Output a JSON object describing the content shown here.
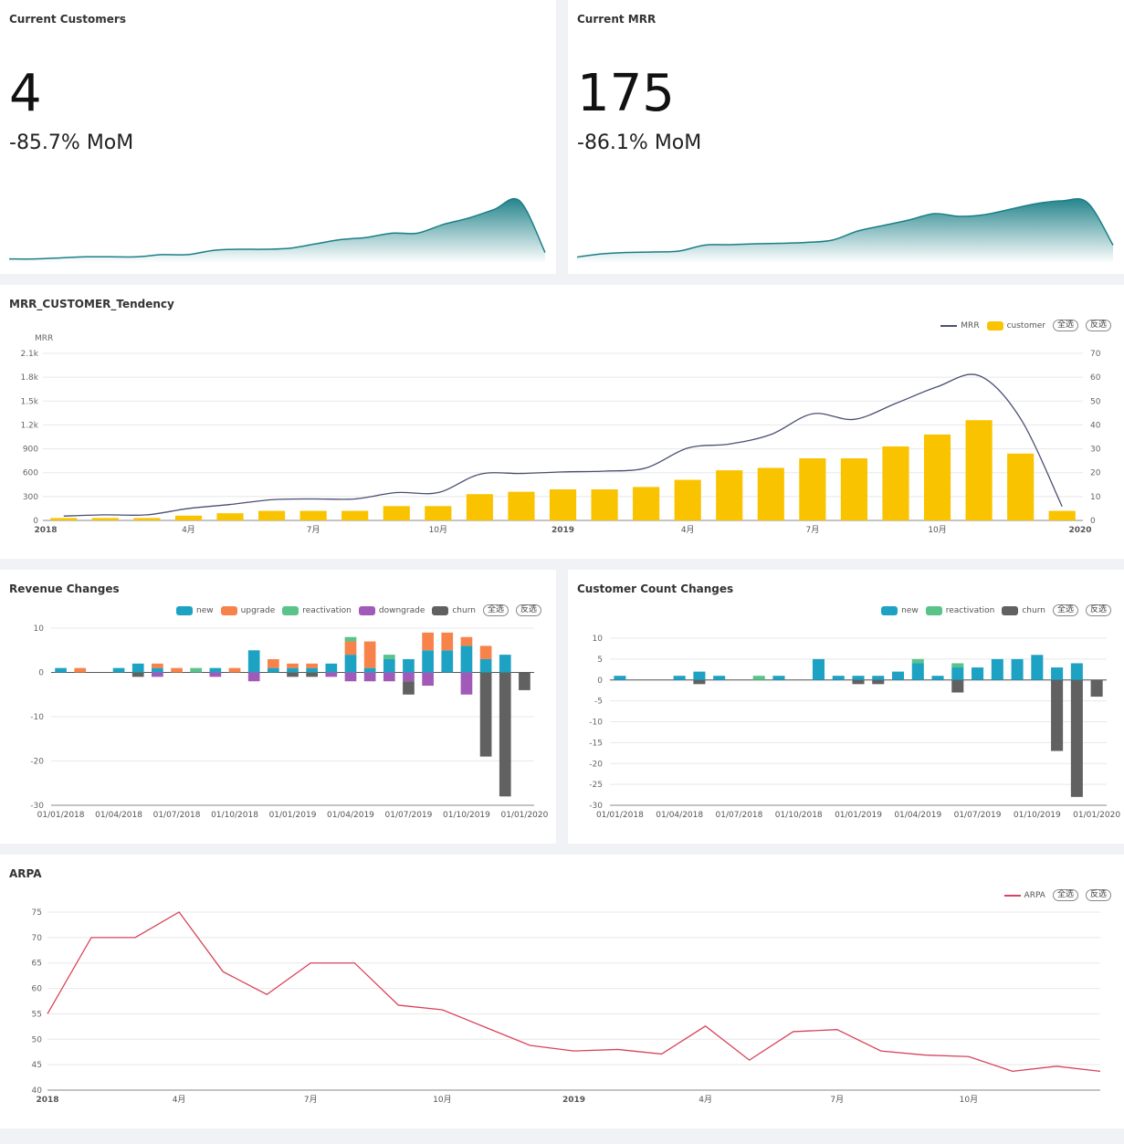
{
  "kpi": [
    {
      "title": "Current Customers",
      "value": "4",
      "mom": "-85.7% MoM"
    },
    {
      "title": "Current MRR",
      "value": "175",
      "mom": "-86.1% MoM"
    }
  ],
  "controls": {
    "select_all": "全选",
    "invert": "反选"
  },
  "colors": {
    "teal": "#1a7f86",
    "yellow": "#f9c300",
    "navy": "#4a4f72",
    "new": "#1ea2c4",
    "upgrade": "#f7834a",
    "reactivation": "#5ac38a",
    "downgrade": "#a25ab8",
    "churn": "#616161",
    "arpa": "#d9435a"
  },
  "mrr_chart": {
    "title": "MRR_CUSTOMER_Tendency",
    "legend": [
      "MRR",
      "customer"
    ]
  },
  "revenue_chart": {
    "title": "Revenue Changes",
    "legend": [
      "new",
      "upgrade",
      "reactivation",
      "downgrade",
      "churn"
    ]
  },
  "count_chart": {
    "title": "Customer Count Changes",
    "legend": [
      "new",
      "reactivation",
      "churn"
    ]
  },
  "arpa_chart": {
    "title": "ARPA",
    "legend": [
      "ARPA"
    ]
  },
  "chart_data": [
    {
      "id": "customers_sparkline",
      "type": "area",
      "values": [
        1,
        1,
        1.5,
        2,
        2,
        2,
        3,
        3,
        5,
        5.5,
        5.5,
        6,
        8,
        10,
        11,
        13,
        13,
        17,
        20,
        24,
        28,
        4
      ]
    },
    {
      "id": "mrr_sparkline",
      "type": "area",
      "values": [
        45,
        80,
        95,
        100,
        110,
        175,
        180,
        190,
        195,
        205,
        230,
        330,
        390,
        450,
        520,
        490,
        510,
        570,
        630,
        660,
        640,
        175
      ]
    },
    {
      "id": "mrr_customer",
      "type": "bar+line",
      "title": "MRR_CUSTOMER_Tendency",
      "x": [
        "2018-01",
        "2018-02",
        "2018-03",
        "2018-04",
        "2018-05",
        "2018-06",
        "2018-07",
        "2018-08",
        "2018-09",
        "2018-10",
        "2018-11",
        "2018-12",
        "2019-01",
        "2019-02",
        "2019-03",
        "2019-04",
        "2019-05",
        "2019-06",
        "2019-07",
        "2019-08",
        "2019-09",
        "2019-10",
        "2019-11",
        "2019-12",
        "2020-01"
      ],
      "x_ticks": [
        "2018",
        "4月",
        "7月",
        "10月",
        "2019",
        "4月",
        "7月",
        "10月",
        "2020"
      ],
      "x_tick_index": [
        0,
        3,
        6,
        9,
        12,
        15,
        18,
        21,
        24
      ],
      "x_tick_bold": [
        true,
        false,
        false,
        false,
        true,
        false,
        false,
        false,
        true
      ],
      "ylabel_left": "MRR",
      "ylim_left": [
        0,
        2100
      ],
      "yticks_left": [
        "0",
        "300",
        "600",
        "900",
        "1.2k",
        "1.5k",
        "1.8k",
        "2.1k"
      ],
      "ylim_right": [
        0,
        70
      ],
      "yticks_right": [
        "0",
        "10",
        "20",
        "30",
        "40",
        "50",
        "60",
        "70"
      ],
      "series": [
        {
          "name": "customer",
          "type": "bar",
          "axis": "right",
          "values": [
            1,
            1,
            1,
            2,
            3,
            4,
            4,
            4,
            6,
            6,
            11,
            12,
            13,
            13,
            14,
            17,
            21,
            22,
            26,
            26,
            31,
            36,
            42,
            28,
            4
          ]
        },
        {
          "name": "MRR",
          "type": "line",
          "axis": "left",
          "values": [
            55,
            70,
            70,
            150,
            200,
            260,
            270,
            270,
            350,
            350,
            580,
            590,
            610,
            620,
            660,
            910,
            960,
            1080,
            1340,
            1270,
            1470,
            1680,
            1820,
            1280,
            175
          ]
        }
      ]
    },
    {
      "id": "revenue_changes",
      "type": "bar",
      "title": "Revenue Changes",
      "stacked": true,
      "x_ticks": [
        "01/01/2018",
        "01/04/2018",
        "01/07/2018",
        "01/10/2018",
        "01/01/2019",
        "01/04/2019",
        "01/07/2019",
        "01/10/2019",
        "01/01/2020"
      ],
      "ylim": [
        -30,
        10
      ],
      "yticks": [
        "-30",
        "-20",
        "-10",
        "0",
        "10"
      ],
      "series": [
        {
          "name": "new",
          "values": [
            1,
            0,
            0,
            1,
            2,
            1,
            0,
            0,
            1,
            0,
            5,
            1,
            1,
            1,
            2,
            4,
            1,
            3,
            3,
            5,
            5,
            6,
            3,
            4,
            0
          ]
        },
        {
          "name": "upgrade",
          "values": [
            0,
            1,
            0,
            0,
            0,
            1,
            1,
            0,
            0,
            1,
            0,
            2,
            1,
            1,
            0,
            3,
            6,
            0,
            0,
            4,
            4,
            2,
            3,
            0,
            0
          ]
        },
        {
          "name": "reactivation",
          "values": [
            0,
            0,
            0,
            0,
            0,
            0,
            0,
            1,
            0,
            0,
            0,
            0,
            0,
            0,
            0,
            1,
            0,
            1,
            0,
            0,
            0,
            0,
            0,
            0,
            0
          ]
        },
        {
          "name": "downgrade",
          "values": [
            0,
            0,
            0,
            0,
            0,
            -1,
            0,
            0,
            -1,
            0,
            -2,
            0,
            0,
            0,
            -1,
            -2,
            -2,
            -2,
            -2,
            -3,
            0,
            -5,
            0,
            0,
            0
          ]
        },
        {
          "name": "churn",
          "values": [
            0,
            0,
            0,
            0,
            -1,
            0,
            0,
            0,
            0,
            0,
            0,
            0,
            -1,
            -1,
            0,
            0,
            0,
            0,
            -3,
            0,
            0,
            0,
            -19,
            -28,
            -4
          ]
        }
      ]
    },
    {
      "id": "customer_count_changes",
      "type": "bar",
      "title": "Customer Count Changes",
      "stacked": true,
      "x_ticks": [
        "01/01/2018",
        "01/04/2018",
        "01/07/2018",
        "01/10/2018",
        "01/01/2019",
        "01/04/2019",
        "01/07/2019",
        "01/10/2019",
        "01/01/2020"
      ],
      "ylim": [
        -30,
        10
      ],
      "yticks": [
        "-30",
        "-25",
        "-20",
        "-15",
        "-10",
        "-5",
        "0",
        "5",
        "10"
      ],
      "series": [
        {
          "name": "new",
          "values": [
            1,
            0,
            0,
            1,
            2,
            1,
            0,
            0,
            1,
            0,
            5,
            1,
            1,
            1,
            2,
            4,
            1,
            3,
            3,
            5,
            5,
            6,
            3,
            4,
            0
          ]
        },
        {
          "name": "reactivation",
          "values": [
            0,
            0,
            0,
            0,
            0,
            0,
            0,
            1,
            0,
            0,
            0,
            0,
            0,
            0,
            0,
            1,
            0,
            1,
            0,
            0,
            0,
            0,
            0,
            0,
            0
          ]
        },
        {
          "name": "churn",
          "values": [
            0,
            0,
            0,
            0,
            -1,
            0,
            0,
            0,
            0,
            0,
            0,
            0,
            -1,
            -1,
            0,
            0,
            0,
            -3,
            0,
            0,
            0,
            0,
            -17,
            -28,
            -4
          ]
        }
      ]
    },
    {
      "id": "arpa",
      "type": "line",
      "title": "ARPA",
      "x_ticks": [
        "2018",
        "4月",
        "7月",
        "10月",
        "2019",
        "4月",
        "7月",
        "10月"
      ],
      "x_tick_index": [
        0,
        3,
        6,
        9,
        12,
        15,
        18,
        21
      ],
      "x_tick_bold": [
        true,
        false,
        false,
        false,
        true,
        false,
        false,
        false
      ],
      "ylim": [
        40,
        75
      ],
      "yticks": [
        "40",
        "45",
        "50",
        "55",
        "60",
        "65",
        "70",
        "75"
      ],
      "series": [
        {
          "name": "ARPA",
          "values": [
            55,
            70,
            70,
            75,
            63.3,
            58.8,
            65,
            65,
            56.7,
            55.8,
            52.3,
            48.8,
            47.7,
            48,
            47.1,
            52.6,
            45.9,
            51.5,
            51.9,
            47.7,
            46.9,
            46.6,
            43.7,
            44.7,
            43.7
          ]
        }
      ]
    }
  ]
}
